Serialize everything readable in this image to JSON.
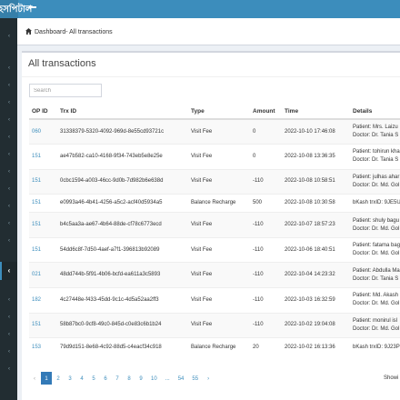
{
  "app": {
    "brand": "হসপিটাল"
  },
  "breadcrumb": {
    "dashboard": "Dashboard",
    "separator": "- ",
    "current": "All transactions"
  },
  "page": {
    "title": "All transactions"
  },
  "search": {
    "placeholder": "Search"
  },
  "table": {
    "headers": [
      "OP ID",
      "Trx ID",
      "Type",
      "Amount",
      "Time",
      "Details"
    ],
    "rows": [
      {
        "op_id": "060",
        "trx_id": "31338379-5320-4092-969d-8e55cd93721c",
        "type": "Visit Fee",
        "amount": "0",
        "time": "2022-10-10 17:46:08",
        "d1": "Patient: Mrs. Laizu",
        "d2": "Doctor: Dr. Tania S"
      },
      {
        "op_id": "151",
        "trx_id": "ae47b582-ca10-4168-9f34-743eb5e8e25e",
        "type": "Visit Fee",
        "amount": "0",
        "time": "2022-10-08 13:36:35",
        "d1": "Patient: tohirun kha",
        "d2": "Doctor: Dr. Tania S"
      },
      {
        "op_id": "151",
        "trx_id": "0cbc1594-a003-46cc-9d0b-7d982b6e638d",
        "type": "Visit Fee",
        "amount": "-110",
        "time": "2022-10-08 10:58:51",
        "d1": "Patient: julhas ahar",
        "d2": "Doctor: Dr. Md. Gol"
      },
      {
        "op_id": "151",
        "trx_id": "e0993a46-4b41-4256-a5c2-acf40d5934a5",
        "type": "Balance Recharge",
        "amount": "500",
        "time": "2022-10-08 10:30:58",
        "d1": "bKash trxID: 9JE5U",
        "d2": ""
      },
      {
        "op_id": "151",
        "trx_id": "b4c5aa3a-ae67-4b64-88de-cf78c6773ecd",
        "type": "Visit Fee",
        "amount": "-110",
        "time": "2022-10-07 18:57:23",
        "d1": "Patient: shuly bagu",
        "d2": "Doctor: Dr. Md. Gol"
      },
      {
        "op_id": "151",
        "trx_id": "54dd6c8f-7d50-4aef-a7f1-396813b92089",
        "type": "Visit Fee",
        "amount": "-110",
        "time": "2022-10-06 18:40:51",
        "d1": "Patient: fatama bag",
        "d2": "Doctor: Dr. Md. Gol"
      },
      {
        "op_id": "021",
        "trx_id": "48dd744b-5f91-4b06-bcfd-ea611a3c5893",
        "type": "Visit Fee",
        "amount": "-110",
        "time": "2022-10-04 14:23:32",
        "d1": "Patient: Abdulla Ma",
        "d2": "Doctor: Dr. Tania S"
      },
      {
        "op_id": "182",
        "trx_id": "4c27448e-f433-45dd-9c1c-4d5a52aa2ff3",
        "type": "Visit Fee",
        "amount": "-110",
        "time": "2022-10-03 16:32:59",
        "d1": "Patient: Md. Akash",
        "d2": "Doctor: Dr. Md. Gol"
      },
      {
        "op_id": "151",
        "trx_id": "58b87bc0-9cf8-49c0-845d-c0e83c6b1b24",
        "type": "Visit Fee",
        "amount": "-110",
        "time": "2022-10-02 19:04:08",
        "d1": "Patient: monirul isl",
        "d2": "Doctor: Dr. Md. Gol"
      },
      {
        "op_id": "153",
        "trx_id": "79d9d151-8e68-4c92-88d5-c4eacf34c918",
        "type": "Balance Recharge",
        "amount": "20",
        "time": "2022-10-02 16:13:36",
        "d1": "bKash trxID: 9J23P",
        "d2": ""
      }
    ]
  },
  "pagination": {
    "prev": "‹",
    "pages": [
      "1",
      "2",
      "3",
      "4",
      "5",
      "6",
      "7",
      "8",
      "9",
      "10",
      "...",
      "54",
      "55"
    ],
    "active_page": "1",
    "next": "›"
  },
  "footer": {
    "showing": "Showi"
  },
  "colors": {
    "primary": "#3c8dbc",
    "sidebar": "#222d32"
  }
}
